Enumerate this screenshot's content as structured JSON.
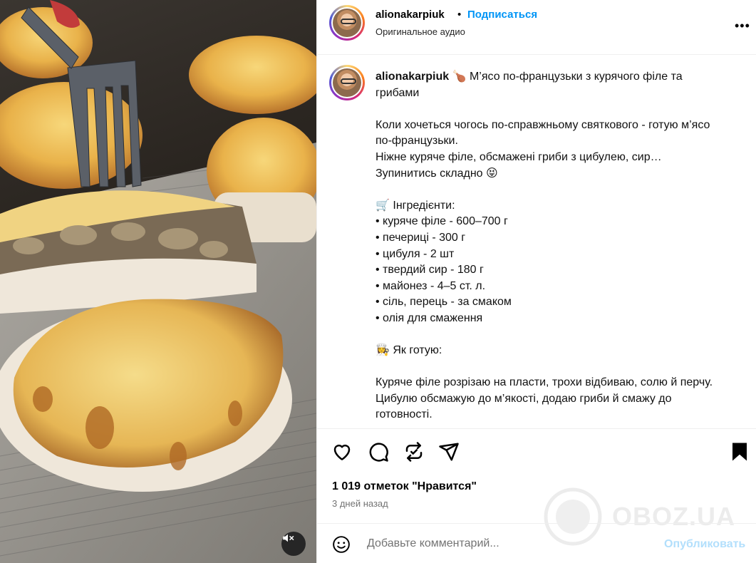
{
  "post": {
    "username": "alionakarpiuk",
    "separator": "•",
    "follow_label": "Подписаться",
    "audio_label": "Оригинальное аудио",
    "more_icon": "more-horizontal-icon",
    "mute_icon": "speaker-muted-icon"
  },
  "caption": {
    "username": "alionakarpiuk",
    "text": " 🍗 М’ясо по-французьки з курячого філе та грибами\n\nКоли хочеться чогось по-справжньому святкового - готую м’ясо по-французьки.\nНіжне куряче філе, обсмажені гриби з цибулею, сир…\nЗупинитись складно 😝\n\n🛒 Інгредієнти:\n• куряче філе - 600–700 г\n• печериці - 300 г\n• цибуля - 2 шт\n• твердий сир - 180 г\n• майонез - 4–5 ст. л.\n• сіль, перець - за смаком\n• олія для смаження\n\n👩‍🍳 Як готую:\n\nКуряче філе розрізаю на пласти, трохи відбиваю, солю й перчу.\nЦибулю обсмажую до м’якості, додаю гриби й смажу до готовності."
  },
  "actions": {
    "icons": [
      "heart-icon",
      "comment-icon",
      "repost-icon",
      "share-icon",
      "bookmark-icon"
    ],
    "likes_text": "1 019 отметок \"Нравится\"",
    "time_ago": "3 дней назад"
  },
  "watermark": {
    "text": "OBOZ.UA"
  },
  "comment": {
    "placeholder": "Добавьте комментарий...",
    "publish_label": "Опубликовать"
  },
  "colors": {
    "link_blue": "#0095f6",
    "publish_disabled": "#b2dffc",
    "muted_text": "#737373",
    "divider": "#efefef"
  }
}
